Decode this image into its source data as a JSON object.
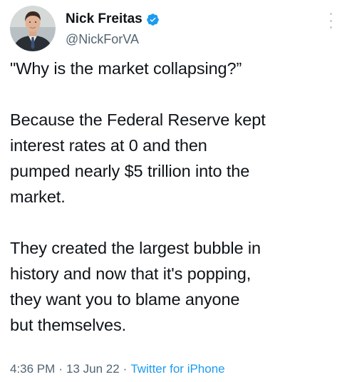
{
  "author": {
    "display_name": "Nick Freitas",
    "handle": "@NickForVA",
    "verified": true,
    "avatar_icon": "profile-photo",
    "verified_icon": "verified-badge-icon",
    "verified_color": "#1d9bf0"
  },
  "tweet": {
    "paragraphs": [
      [
        "\"Why is the market collapsing?”"
      ],
      [
        "Because the Federal Reserve kept",
        "interest rates at 0 and then",
        "pumped nearly $5 trillion into the",
        "market."
      ],
      [
        "They created the largest bubble in",
        "history and now that it's popping,",
        "they want you to blame anyone",
        "but themselves."
      ]
    ]
  },
  "meta": {
    "time": "4:36 PM",
    "date": "13 Jun 22",
    "separator": "·",
    "source": "Twitter for iPhone",
    "source_color": "#1d9bf0"
  }
}
